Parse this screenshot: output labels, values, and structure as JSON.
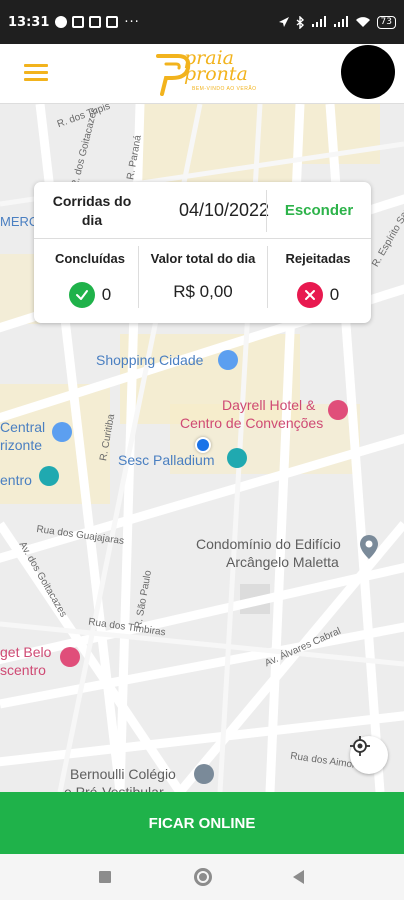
{
  "status_bar": {
    "time": "13:31",
    "dots": "···",
    "battery": "73"
  },
  "header": {
    "logo_text_line1": "praia",
    "logo_text_line2": "pronta",
    "logo_tagline": "BEM-VINDO AO VERÃO"
  },
  "summary": {
    "corridas_label": "Corridas do dia",
    "date": "04/10/2022",
    "hide_label": "Esconder",
    "stats": [
      {
        "label": "Concluídas",
        "value": "0"
      },
      {
        "label": "Valor total do dia",
        "value": "R$ 0,00"
      },
      {
        "label": "Rejeitadas",
        "value": "0"
      }
    ]
  },
  "map": {
    "places": {
      "shopping": "Shopping Cidade",
      "dayrell_line1": "Dayrell Hotel &",
      "dayrell_line2": "Centro de Convenções",
      "sesc": "Sesc Palladium",
      "condominio_line1": "Condomínio do Edifício",
      "condominio_line2": "Arcângelo Maletta",
      "central_line1": "Central",
      "central_line2": "rizonte",
      "centro": "entro",
      "merc": "MERC",
      "get_belo_line1": "get Belo",
      "get_belo_line2": "scentro",
      "bernoulli_line1": "Bernoulli Colégio",
      "bernoulli_line2": "e Pré-Vestibular"
    },
    "streets": {
      "guajajaras": "Rua dos Guajajaras",
      "timbiras": "Rua dos Timbiras",
      "alvares_cabral": "Av. Álvares Cabral",
      "aimores": "Rua dos Aimorés",
      "espirito_santo": "R. Espírito Santo",
      "sao_paulo": "R. São Paulo",
      "curitiba": "R. Curitiba",
      "goitacazes": "R. dos Goitacazes",
      "parana": "R. Paraná",
      "tupis": "R. dos Tupis",
      "goitacazes2": "Av. dos Goitacazes"
    }
  },
  "actions": {
    "go_online": "FICAR ONLINE"
  },
  "colors": {
    "brand": "#f2b31d",
    "success": "#1fb24a",
    "error": "#e8194f"
  }
}
